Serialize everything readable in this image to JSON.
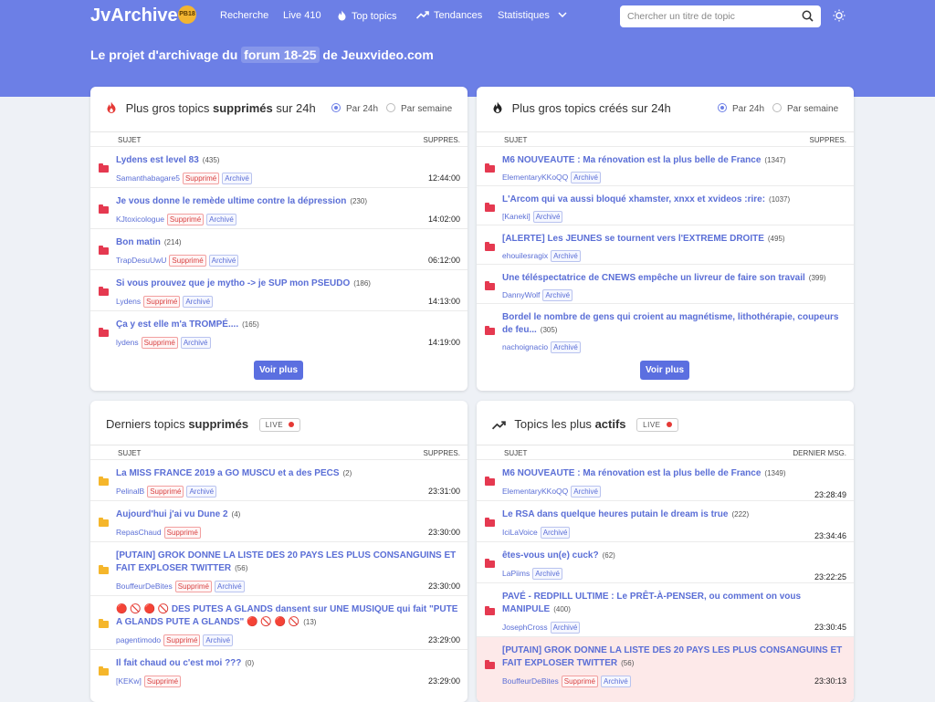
{
  "nav": {
    "logo": "JvArchive",
    "badge": "PB18",
    "links": [
      "Recherche",
      "Live 410",
      "Top topics",
      "Tendances",
      "Statistiques"
    ],
    "search_placeholder": "Chercher un titre de topic"
  },
  "hero": {
    "tagline_pre": "Le projet d'archivage du",
    "tagline_hl": "forum 18-25",
    "tagline_post": "de Jeuxvideo.com"
  },
  "cards": {
    "deleted24": {
      "title_pre": "Plus gros topics",
      "title_bold": "supprimés",
      "title_post": "sur 24h",
      "radio1": "Par 24h",
      "radio2": "Par semaine",
      "col1": "SUJET",
      "col2": "SUPPRES.",
      "button": "Voir plus",
      "rows": [
        {
          "title": "Lydens est level 83",
          "count": "(435)",
          "author": "Samanthabagare5",
          "sup": "Supprimé",
          "arc": "Archivé",
          "time": "12:44:00"
        },
        {
          "title": "Je vous donne le remède ultime contre la dépression",
          "count": "(230)",
          "author": "KJtoxicologue",
          "sup": "Supprimé",
          "arc": "Archivé",
          "time": "14:02:00"
        },
        {
          "title": "Bon matin",
          "count": "(214)",
          "author": "TrapDesuUwU",
          "sup": "Supprimé",
          "arc": "Archivé",
          "time": "06:12:00"
        },
        {
          "title": "Si vous prouvez que je mytho -> je SUP mon PSEUDO",
          "count": "(186)",
          "author": "Lydens",
          "sup": "Supprimé",
          "arc": "Archivé",
          "time": "14:13:00"
        },
        {
          "title": "Ça y est elle m'a TROMPÉ....",
          "count": "(165)",
          "author": "lydens",
          "sup": "Supprimé",
          "arc": "Archivé",
          "time": "14:19:00"
        }
      ]
    },
    "created24": {
      "title_pre": "Plus gros topics",
      "title_bold": "",
      "title_post": "créés sur 24h",
      "radio1": "Par 24h",
      "radio2": "Par semaine",
      "col1": "SUJET",
      "col2": "SUPPRES.",
      "button": "Voir plus",
      "rows": [
        {
          "title": "M6 NOUVEAUTE : Ma rénovation est la plus belle de France",
          "count": "(1347)",
          "author": "ElementaryKKoQQ",
          "arc": "Archivé"
        },
        {
          "title": "L'Arcom qui va aussi bloqué xhamster, xnxx et xvideos :rire:",
          "count": "(1037)",
          "author": "[Kaneki]",
          "arc": "Archivé"
        },
        {
          "title": "[ALERTE] Les JEUNES se tournent vers l'EXTREME DROITE",
          "count": "(495)",
          "author": "ehouilesragix",
          "arc": "Archivé"
        },
        {
          "title": "Une téléspectatrice de CNEWS empêche un livreur de faire son travail",
          "count": "(399)",
          "author": "DannyWolf",
          "arc": "Archivé"
        },
        {
          "title": "Bordel le nombre de gens qui croient au magnétisme, lithothérapie, coupeurs de feu...",
          "count": "(305)",
          "author": "nachoignacio",
          "arc": "Archivé"
        }
      ]
    },
    "latest_deleted": {
      "title_pre": "Derniers topics",
      "title_bold": "supprimés",
      "live": "LIVE",
      "col1": "SUJET",
      "col2": "SUPPRES.",
      "rows": [
        {
          "title": "La MISS FRANCE 2019 a GO MUSCU et a des PECS",
          "count": "(2)",
          "author": "PelinalB",
          "sup": "Supprimé",
          "arc": "Archivé",
          "time": "23:31:00"
        },
        {
          "title": "Aujourd'hui j'ai vu Dune 2",
          "count": "(4)",
          "author": "RepasChaud",
          "sup": "Supprimé",
          "arc": "",
          "time": "23:30:00"
        },
        {
          "title": "[PUTAIN] GROK DONNE LA LISTE DES 20 PAYS LES PLUS CONSANGUINS ET FAIT EXPLOSER TWITTER",
          "count": "(56)",
          "author": "BouffeurDeBites",
          "sup": "Supprimé",
          "arc": "Archivé",
          "time": "23:30:00"
        },
        {
          "title": "🔴 🚫 🔴 🚫 DES PUTES A GLANDS dansent sur UNE MUSIQUE qui fait \"PUTE A GLANDS PUTE A GLANDS\" 🔴 🚫 🔴 🚫",
          "count": "(13)",
          "author": "pagentimodo",
          "sup": "Supprimé",
          "arc": "Archivé",
          "time": "23:29:00"
        },
        {
          "title": "Il fait chaud ou c'est moi ???",
          "count": "(0)",
          "author": "[KEKw]",
          "sup": "Supprimé",
          "arc": "",
          "time": "23:29:00"
        }
      ]
    },
    "most_active": {
      "title_pre": "Topics les plus",
      "title_bold": "actifs",
      "live": "LIVE",
      "col1": "SUJET",
      "col2": "DERNIER MSG.",
      "rows": [
        {
          "title": "M6 NOUVEAUTE : Ma rénovation est la plus belle de France",
          "count": "(1349)",
          "author": "ElementaryKKoQQ",
          "sup": "",
          "arc": "Archivé",
          "time": "23:28:49"
        },
        {
          "title": "Le RSA dans quelque heures putain le dream is true",
          "count": "(222)",
          "author": "IciLaVoice",
          "sup": "",
          "arc": "Archivé",
          "time": "23:34:46"
        },
        {
          "title": "êtes-vous un(e) cuck?",
          "count": "(62)",
          "author": "LaPiims",
          "sup": "",
          "arc": "Archivé",
          "time": "23:22:25"
        },
        {
          "title": "PAVÉ - REDPILL ULTIME : Le PRÊT-À-PENSER, ou comment on vous MANIPULE",
          "count": "(400)",
          "author": "JosephCross",
          "sup": "",
          "arc": "Archivé",
          "time": "23:30:45"
        },
        {
          "title": "[PUTAIN] GROK DONNE LA LISTE DES 20 PAYS LES PLUS CONSANGUINS ET FAIT EXPLOSER TWITTER",
          "count": "(56)",
          "author": "BouffeurDeBites",
          "sup": "Supprimé",
          "arc": "Archivé",
          "time": "23:30:13"
        }
      ]
    }
  },
  "colors": {
    "brand": "#6c7fe6",
    "link": "#5a6ed6",
    "folder_red": "#e53950",
    "folder_yellow": "#f5b62b",
    "deleted_row": "#fde9e9"
  }
}
